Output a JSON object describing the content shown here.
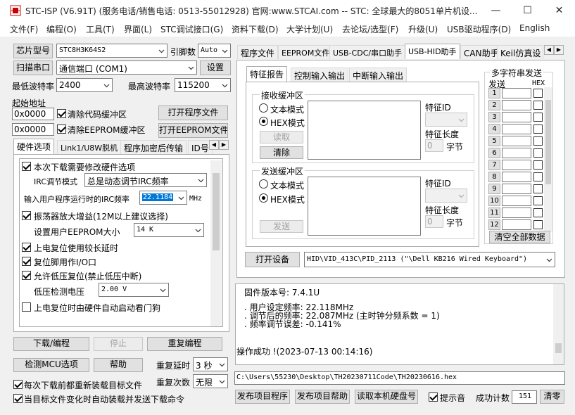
{
  "window": {
    "title": "STC-ISP (V6.91T) (服务电话/销售电话: 0513-55012928) 官网:www.STCAI.com  -- STC: 全球最大的8051单片机设...",
    "controls": [
      "—",
      "☐",
      "✕"
    ]
  },
  "menu": [
    "文件(F)",
    "编程(O)",
    "工具(T)",
    "界面(L)",
    "STC调试接口(G)",
    "资料下载(D)",
    "大学计划(U)",
    "去论坛/选型(F)",
    "升级(U)",
    "USB驱动程序(D)",
    "English"
  ],
  "left": {
    "chip_label": "芯片型号",
    "chip_value": "STC8H3K64S2",
    "pins_label": "引脚数",
    "pins_value": "Auto",
    "scan_port": "扫描串口",
    "port_value": "通信端口 (COM1)",
    "settings": "设置",
    "min_baud_label": "最低波特率",
    "min_baud": "2400",
    "max_baud_label": "最高波特率",
    "max_baud": "115200",
    "start_addr_label": "起始地址",
    "addr1": "0x0000",
    "clear_code": "清除代码缓冲区",
    "open_prog": "打开程序文件",
    "addr2": "0x0000",
    "clear_eeprom": "清除EEPROM缓冲区",
    "open_eeprom": "打开EEPROM文件",
    "tabs": [
      "硬件选项",
      "Link1/U8W脱机",
      "程序加密后传输",
      "ID号"
    ],
    "hw": {
      "opt1": "本次下载需要修改硬件选项",
      "irc_mode_label": "IRC调节模式",
      "irc_mode": "总是动态调节IRC频率",
      "irc_freq_label": "输入用户程序运行时的IRC频率",
      "irc_freq": "22.1184",
      "mhz": "MHz",
      "osc_gain": "振荡器放大增益(12M以上建议选择)",
      "eeprom_size_label": "设置用户EEPROM大小",
      "eeprom_size": "14   K",
      "long_delay": "上电复位使用较长延时",
      "reset_io": "复位脚用作I/O口",
      "low_volt": "允许低压复位(禁止低压中断)",
      "low_volt_label": "低压检测电压",
      "low_volt_value": "2.00 V",
      "watchdog": "上电复位时由硬件自动启动看门狗"
    },
    "download": "下载/编程",
    "stop": "停止",
    "reprogram": "重复编程",
    "detect_mcu": "检测MCU选项",
    "help": "帮助",
    "repeat_delay_label": "重复延时",
    "repeat_delay": "3 秒",
    "repeat_count_label": "重复次数",
    "repeat_count": "无限",
    "reload_before": "每次下载前都重新装载目标文件",
    "auto_reload": "当目标文件变化时自动装载并发送下载命令"
  },
  "right": {
    "tabs": [
      "程序文件",
      "EEPROM文件",
      "USB-CDC/串口助手",
      "USB-HID助手",
      "CAN助手",
      "Keil仿真设"
    ],
    "hid": {
      "subtabs": [
        "特征报告",
        "控制输入输出",
        "中断输入输出"
      ],
      "recv_title": "接收缓冲区",
      "send_title": "发送缓冲区",
      "text_mode": "文本模式",
      "hex_mode": "HEX模式",
      "read": "读取",
      "clear": "清除",
      "send": "发送",
      "feature_id": "特征ID",
      "feature_len": "特征长度",
      "len_value": "0",
      "bytes": "字节",
      "multi_title": "多字符串发送",
      "send_col": "发送",
      "hex_col": "HEX",
      "rows": [
        "1",
        "2",
        "3",
        "4",
        "5",
        "6",
        "7",
        "8",
        "9",
        "10",
        "11",
        "12"
      ],
      "clear_all": "清空全部数据",
      "open_device": "打开设备",
      "device_value": "HID\\VID_413C\\PID_2113 (\"\\Dell KB216 Wired Keyboard\")"
    },
    "log": {
      "fw": "固件版本号: 7.4.1U",
      "l1": ". 用户设定频率: 22.118MHz",
      "l2": ". 调节后的频率: 22.087MHz (主时钟分频系数 = 1)",
      "l3": ". 频率调节误差: -0.141%",
      "ok": "操作成功 !(2023-07-13 00:14:16)"
    },
    "path": "C:\\Users\\55230\\Desktop\\TH20230711Code\\TH20230616.hex",
    "publish": "发布项目程序",
    "publish_help": "发布项目帮助",
    "read_serial": "读取本机硬盘号",
    "beep": "提示音",
    "success_label": "成功计数",
    "success_count": "151",
    "clear": "清零"
  }
}
